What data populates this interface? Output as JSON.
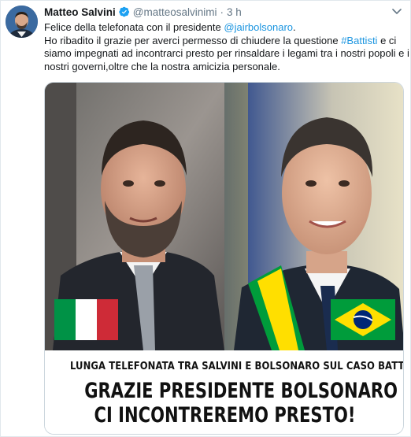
{
  "tweet": {
    "author_name": "Matteo Salvini",
    "handle": "@matteosalvinimi",
    "separator": "·",
    "time": "3 h",
    "verified_icon": "verified-badge-icon",
    "menu_icon": "chevron-down-icon",
    "text": {
      "line1_prefix": "Felice della telefonata con il presidente ",
      "line1_mention": "@jairbolsonaro",
      "line1_suffix": ".",
      "line2_prefix": "Ho ribadito il grazie per averci permesso di chiudere la questione ",
      "line2_hashtag": "#Battisti",
      "line2_suffix": " e ci",
      "line3": "siamo impegnati ad incontrarci presto per rinsaldare i legami tra i nostri popoli e i",
      "line4": "nostri governi,oltre che la nostra amicizia personale."
    },
    "media": {
      "caption_sub": "LUNGA TELEFONATA TRA SALVINI E BOLSONARO SUL CASO BATTISTI",
      "caption_line1": "GRAZIE PRESIDENTE BOLSONARO",
      "caption_line2": "CI INCONTREREMO PRESTO!"
    }
  },
  "colors": {
    "link": "#1b95e0",
    "verified": "#1da1f2",
    "secondary_text": "#657786",
    "italy_green": "#009246",
    "italy_red": "#ce2b37",
    "brazil_green": "#009c3b",
    "brazil_yellow": "#ffdf00",
    "brazil_blue": "#002776"
  }
}
